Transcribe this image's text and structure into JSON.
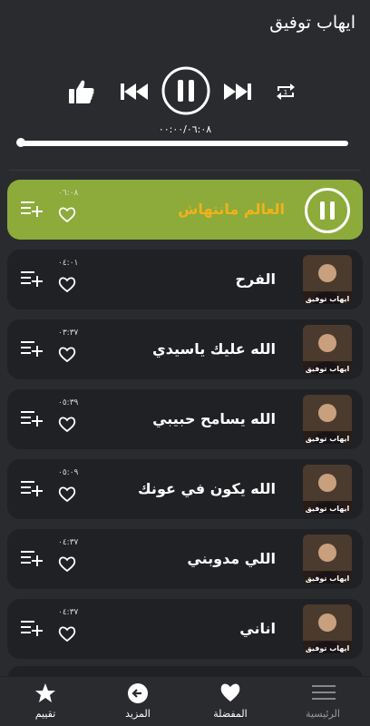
{
  "header": {
    "title": "ايهاب توفيق"
  },
  "player": {
    "time": "٠٠:٠٠/٠٦:٠٨",
    "progress": 0.01,
    "icons": [
      "thumbs-up-icon",
      "previous-icon",
      "pause-icon",
      "next-icon",
      "repeat-icon"
    ]
  },
  "songs": [
    {
      "title": "العالم مانتهاش",
      "duration": "٠٦:٠٨",
      "active": true
    },
    {
      "title": "الفرح",
      "duration": "٠٤:٠١",
      "thumb_caption": "ايهاب توفيق"
    },
    {
      "title": "الله عليك ياسيدي",
      "duration": "٠٣:٣٧",
      "thumb_caption": "ايهاب توفيق"
    },
    {
      "title": "الله يسامح حبيبي",
      "duration": "٠٥:٣٩",
      "thumb_caption": "ايهاب توفيق"
    },
    {
      "title": "الله يكون في عونك",
      "duration": "٠٥:٠٩",
      "thumb_caption": "ايهاب توفيق"
    },
    {
      "title": "اللي مدوبني",
      "duration": "٠٤:٣٧",
      "thumb_caption": "ايهاب توفيق"
    },
    {
      "title": "اناني",
      "duration": "٠٤:٣٧",
      "thumb_caption": "ايهاب توفيق"
    }
  ],
  "nav": {
    "home": "الرئيسية",
    "favorites": "المفضلة",
    "more": "المزيد",
    "rate": "تقييم"
  },
  "colors": {
    "background": "#2a2b2f",
    "row": "#202124",
    "active_row": "#8cab3a",
    "active_title": "#f2b21a"
  }
}
